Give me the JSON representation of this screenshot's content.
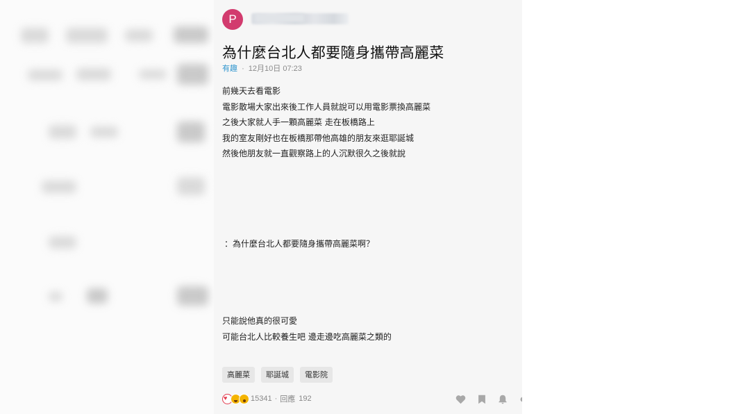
{
  "post": {
    "avatar_letter": "P",
    "title": "為什麼台北人都要隨身攜帶高麗菜",
    "forum": "有趣",
    "separator": "·",
    "datetime": "12月10日 07:23",
    "paragraph1": [
      "前幾天去看電影",
      "電影散場大家出來後工作人員就說可以用電影票換高麗菜",
      "之後大家就人手一顆高麗菜 走在板橋路上",
      "我的室友剛好也在板橋那帶他高雄的朋友來逛耶誕城",
      "然後他朋友就一直觀察路上的人沉默很久之後就說"
    ],
    "paragraph2": [
      "：為什麼台北人都要隨身攜帶高麗菜啊？"
    ],
    "paragraph3": [
      "只能說他真的很可愛",
      "可能台北人比較養生吧 邊走邊吃高麗菜之類的"
    ],
    "tags": [
      "高麗菜",
      "耶誕城",
      "電影院"
    ],
    "reaction_icons": [
      "heart-reaction",
      "haha-reaction",
      "wow-reaction"
    ],
    "reaction_count": "15341",
    "comment_label": "回應",
    "comment_count": "192"
  },
  "colors": {
    "avatar": "#d23b6e",
    "forum_link": "#3397cf",
    "panel_bg": "#f6f6f6",
    "tag_bg": "#e7e7e7",
    "action_icons": "#a8a8a8"
  },
  "action_icons": [
    "like-icon",
    "bookmark-icon",
    "bell-icon",
    "more-icon"
  ]
}
